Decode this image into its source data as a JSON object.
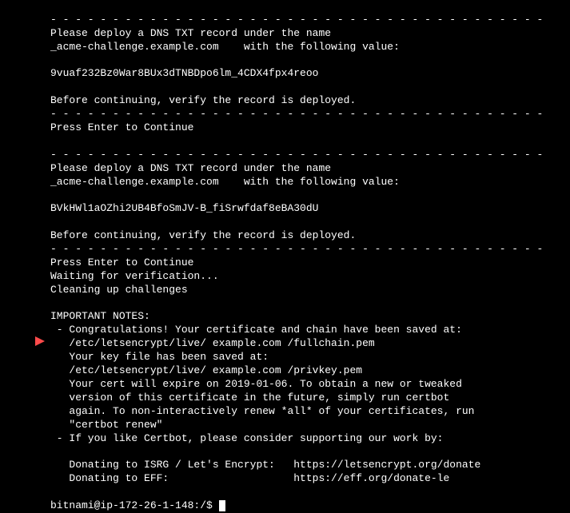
{
  "terminal": {
    "dashes1": "- - - - - - - - - - - - - - - - - - - - - - - - - - - - - - - - - - - - - - - -",
    "deploy1_line1": "Please deploy a DNS TXT record under the name",
    "deploy1_line2": "_acme-challenge.example.com    with the following value:",
    "token1": "9vuaf232Bz0War8BUx3dTNBDpo6lm_4CDX4fpx4reoo",
    "verify1": "Before continuing, verify the record is deployed.",
    "dashes2": "- - - - - - - - - - - - - - - - - - - - - - - - - - - - - - - - - - - - - - - -",
    "press1": "Press Enter to Continue",
    "blank1": "",
    "dashes3": "- - - - - - - - - - - - - - - - - - - - - - - - - - - - - - - - - - - - - - - -",
    "deploy2_line1": "Please deploy a DNS TXT record under the name",
    "deploy2_line2": "_acme-challenge.example.com    with the following value:",
    "token2": "BVkHWl1aOZhi2UB4BfoSmJV-B_fiSrwfdaf8eBA30dU",
    "verify2": "Before continuing, verify the record is deployed.",
    "dashes4": "- - - - - - - - - - - - - - - - - - - - - - - - - - - - - - - - - - - - - - - -",
    "press2": "Press Enter to Continue",
    "waiting": "Waiting for verification...",
    "cleaning": "Cleaning up challenges",
    "important": "IMPORTANT NOTES:",
    "note1_line1": " - Congratulations! Your certificate and chain have been saved at:",
    "note1_line2": "   /etc/letsencrypt/live/ example.com /fullchain.pem",
    "note1_line3": "   Your key file has been saved at:",
    "note1_line4": "   /etc/letsencrypt/live/ example.com /privkey.pem",
    "note1_line5": "   Your cert will expire on 2019-01-06. To obtain a new or tweaked",
    "note1_line6": "   version of this certificate in the future, simply run certbot",
    "note1_line7": "   again. To non-interactively renew *all* of your certificates, run",
    "note1_line8": "   \"certbot renew\"",
    "note2_line1": " - If you like Certbot, please consider supporting our work by:",
    "donate1": "   Donating to ISRG / Let's Encrypt:   https://letsencrypt.org/donate",
    "donate2": "   Donating to EFF:                    https://eff.org/donate-le",
    "prompt": "bitnami@ip-172-26-1-148:/$ "
  }
}
